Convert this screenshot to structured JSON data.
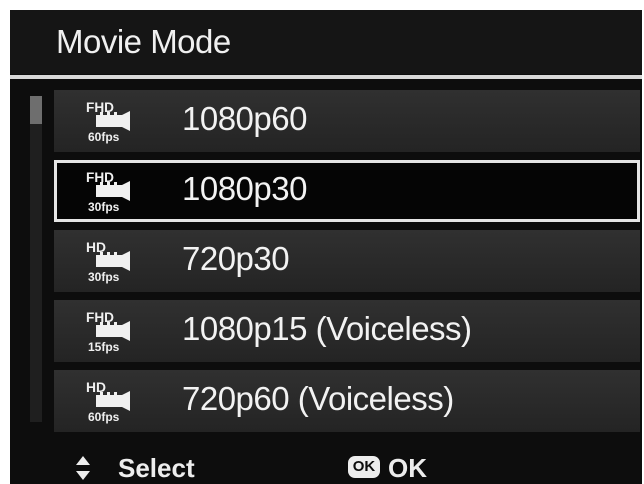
{
  "header": {
    "title": "Movie Mode"
  },
  "menu": {
    "items": [
      {
        "label": "1080p60",
        "icon": {
          "res": "FHD",
          "fps": "60fps",
          "name": "fhd-60fps-icon"
        },
        "selected": false
      },
      {
        "label": "1080p30",
        "icon": {
          "res": "FHD",
          "fps": "30fps",
          "name": "fhd-30fps-icon"
        },
        "selected": true
      },
      {
        "label": "720p30",
        "icon": {
          "res": "HD",
          "fps": "30fps",
          "name": "hd-30fps-icon"
        },
        "selected": false
      },
      {
        "label": "1080p15 (Voiceless)",
        "icon": {
          "res": "FHD",
          "fps": "15fps",
          "name": "fhd-15fps-icon"
        },
        "selected": false
      },
      {
        "label": "720p60 (Voiceless)",
        "icon": {
          "res": "HD",
          "fps": "60fps",
          "name": "hd-60fps-icon"
        },
        "selected": false
      }
    ]
  },
  "footer": {
    "select_label": "Select",
    "select_icon": "up-down-arrows-icon",
    "ok_badge": "OK",
    "ok_label": "OK",
    "ok_icon": "ok-button-icon"
  },
  "colors": {
    "background": "#0d0d0d",
    "text": "#f2f2f2",
    "selection_border": "#e6e6e6",
    "item_background": "#2c2c2c"
  }
}
